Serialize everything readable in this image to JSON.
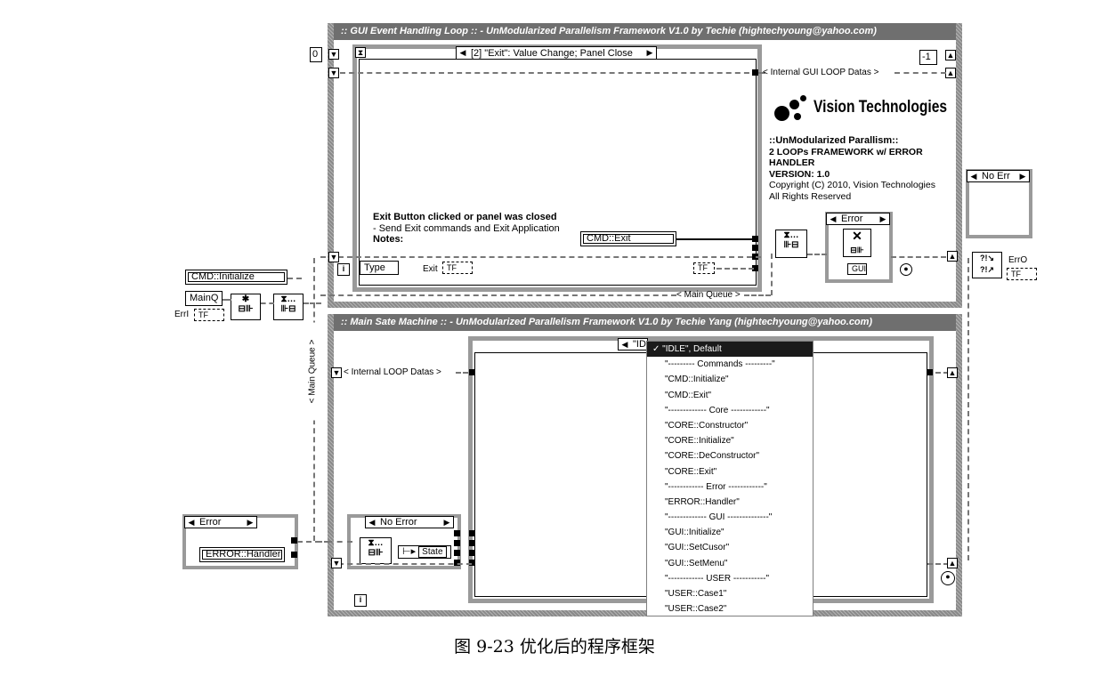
{
  "gui_loop": {
    "title": ":: GUI Event Handling Loop :: - UnModularized Parallelism Framework V1.0 by Techie (hightechyoung@yahoo.com)",
    "iteration_const": "0",
    "event_selector": "[2] \"Exit\": Value Change;  Panel Close",
    "shift_reg_label": "< Internal GUI LOOP Datas >",
    "right_const": "-1",
    "exit_caption_bold": "Exit Button clicked or panel was closed",
    "exit_caption_line": "- Send Exit commands and Exit Application",
    "notes_label": "Notes:",
    "cmd_exit_const": "CMD::Exit",
    "type_label": "Type",
    "exit_label": "Exit",
    "exit_indicator": "TF",
    "gui_indicator": "TF",
    "main_queue_label": "< Main Queue >",
    "iteration_terminal": "i",
    "error_case_selector": "Error",
    "error_inner_icon": "GUI"
  },
  "branding": {
    "company": "Vision Technologies",
    "heading": "::UnModularized Parallism::",
    "line1": "2 LOOPs FRAMEWORK w/ ERROR",
    "line2": "HANDLER",
    "version": "VERSION: 1.0",
    "copyright": "Copyright (C) 2010, Vision Technologies",
    "rights": "All Rights Reserved"
  },
  "outside": {
    "cmd_init_const": "CMD::Initialize",
    "mainq_label": "MainQ",
    "erri_label": "ErrI",
    "erro_label": "ErrO",
    "no_err_selector": "No Err",
    "error_selector": "Error",
    "error_handler_const": "ERROR::Handler",
    "main_queue_vertical": "< Main Queue >"
  },
  "state_loop": {
    "title": ":: Main Sate Machine :: - UnModularized Parallelism Framework V1.0 by Techie Yang (hightechyoung@yahoo.com)",
    "case_selector_visible": "\"ID",
    "shift_reg_label": "< Internal LOOP Datas >",
    "no_error_selector": "No Error",
    "state_label": "State",
    "iteration_terminal": "i"
  },
  "case_menu": {
    "items": [
      "\"IDLE\", Default",
      "\"--------- Commands ---------\"",
      "\"CMD::Initialize\"",
      "\"CMD::Exit\"",
      "\"------------- Core ------------\"",
      "\"CORE::Constructor\"",
      "\"CORE::Initialize\"",
      "\"CORE::DeConstructor\"",
      "\"CORE::Exit\"",
      "\"------------ Error ------------\"",
      "\"ERROR::Handler\"",
      "\"------------- GUI --------------\"",
      "\"GUI::Initialize\"",
      "\"GUI::SetCusor\"",
      "\"GUI::SetMenu\"",
      "\"------------ USER -----------\"",
      "\"USER::Case1\"",
      "\"USER::Case2\""
    ],
    "selected_index": 0,
    "check_mark": "✓"
  },
  "caption": "图 9-23   优化后的程序框架"
}
